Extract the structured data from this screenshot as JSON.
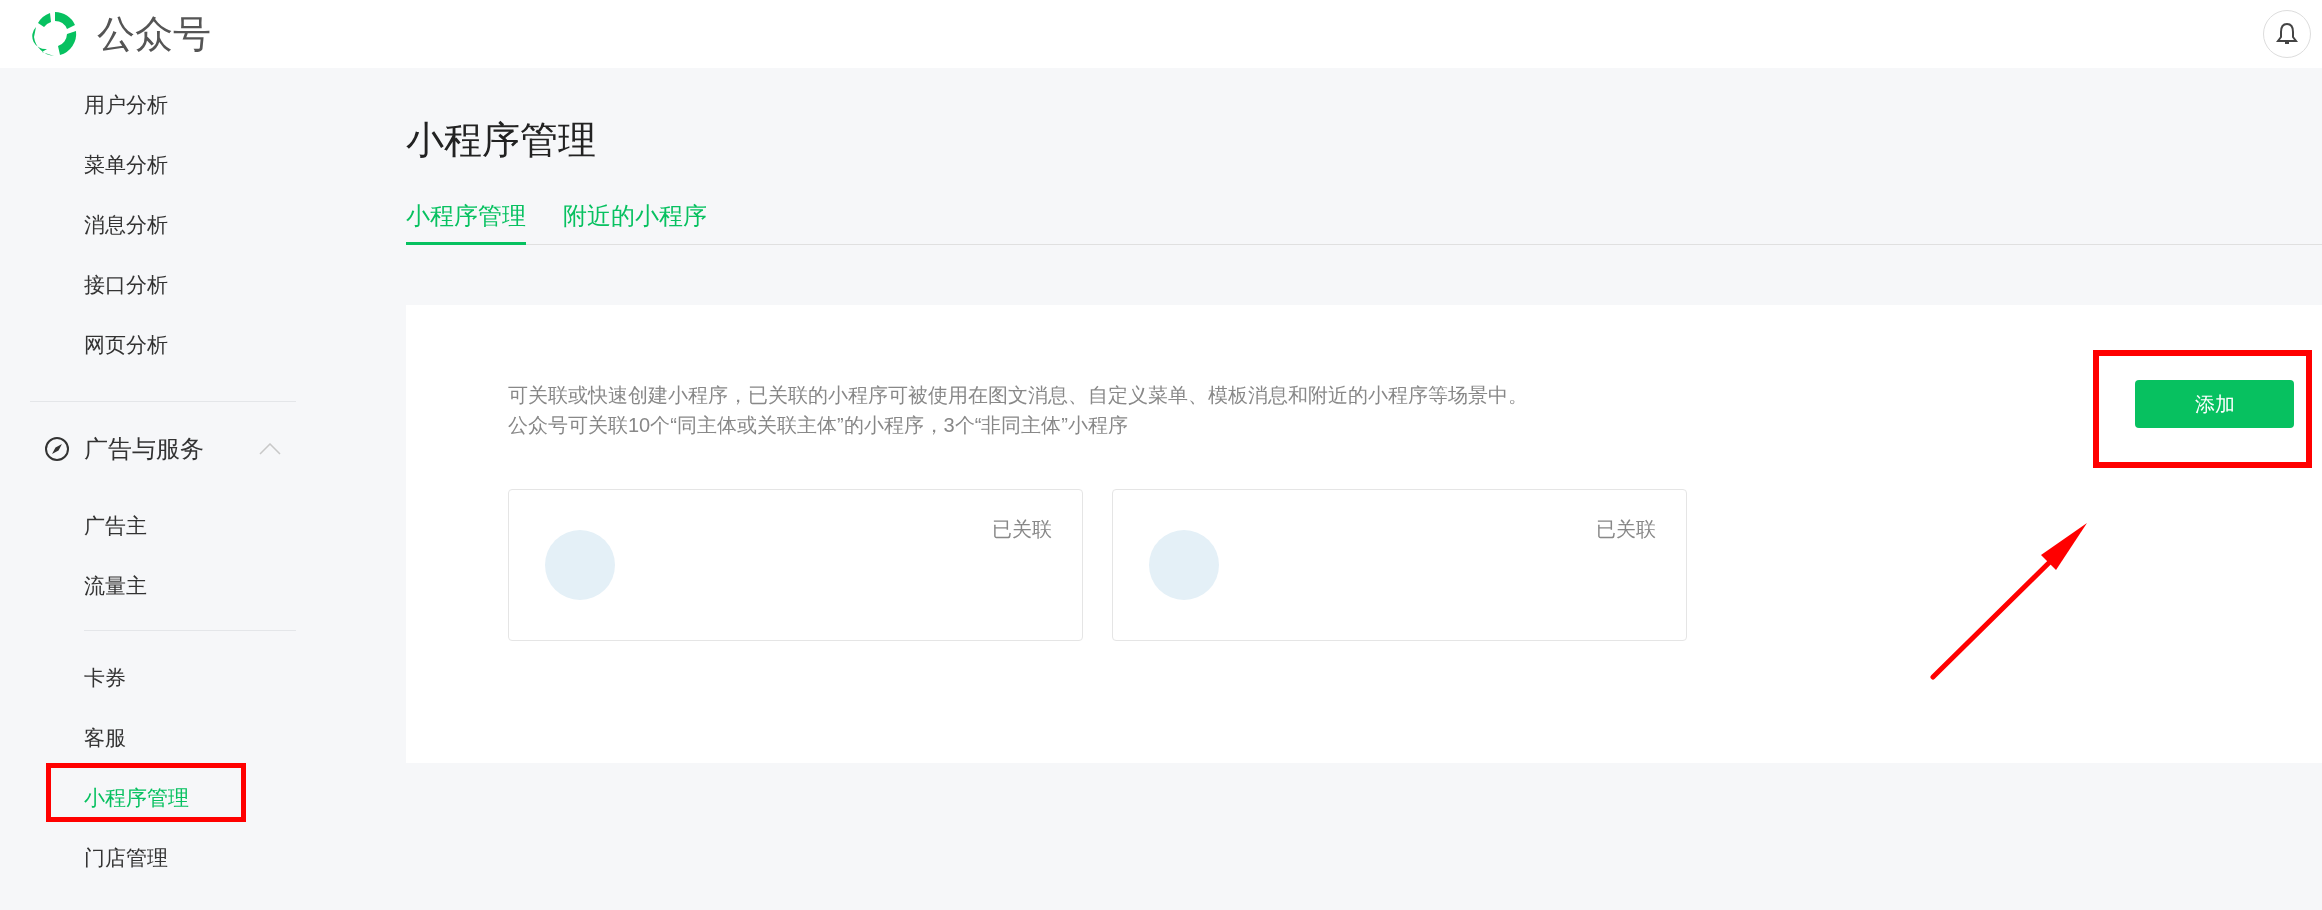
{
  "header": {
    "title": "公众号"
  },
  "sidebar": {
    "sections": [
      {
        "items": [
          {
            "label": "用户分析",
            "selected": false
          },
          {
            "label": "菜单分析",
            "selected": false
          },
          {
            "label": "消息分析",
            "selected": false
          },
          {
            "label": "接口分析",
            "selected": false
          },
          {
            "label": "网页分析",
            "selected": false
          }
        ]
      },
      {
        "label": "广告与服务",
        "expanded": true,
        "items": [
          {
            "label": "广告主",
            "selected": false
          },
          {
            "label": "流量主",
            "selected": false
          }
        ]
      },
      {
        "items": [
          {
            "label": "卡券",
            "selected": false
          },
          {
            "label": "客服",
            "selected": false
          },
          {
            "label": "小程序管理",
            "selected": true
          },
          {
            "label": "门店管理",
            "selected": false
          }
        ]
      }
    ]
  },
  "main": {
    "title": "小程序管理",
    "tabs": [
      {
        "label": "小程序管理",
        "selected": true
      },
      {
        "label": "附近的小程序",
        "selected": false
      }
    ],
    "description": [
      "可关联或快速创建小程序，已关联的小程序可被使用在图文消息、自定义菜单、模板消息和附近的小程序等场景中。",
      "公众号可关联10个“同主体或关联主体”的小程序，3个“非同主体”小程序"
    ],
    "add_button": "添加",
    "linked_apps": [
      {
        "status": "已关联"
      },
      {
        "status": "已关联"
      }
    ]
  }
}
